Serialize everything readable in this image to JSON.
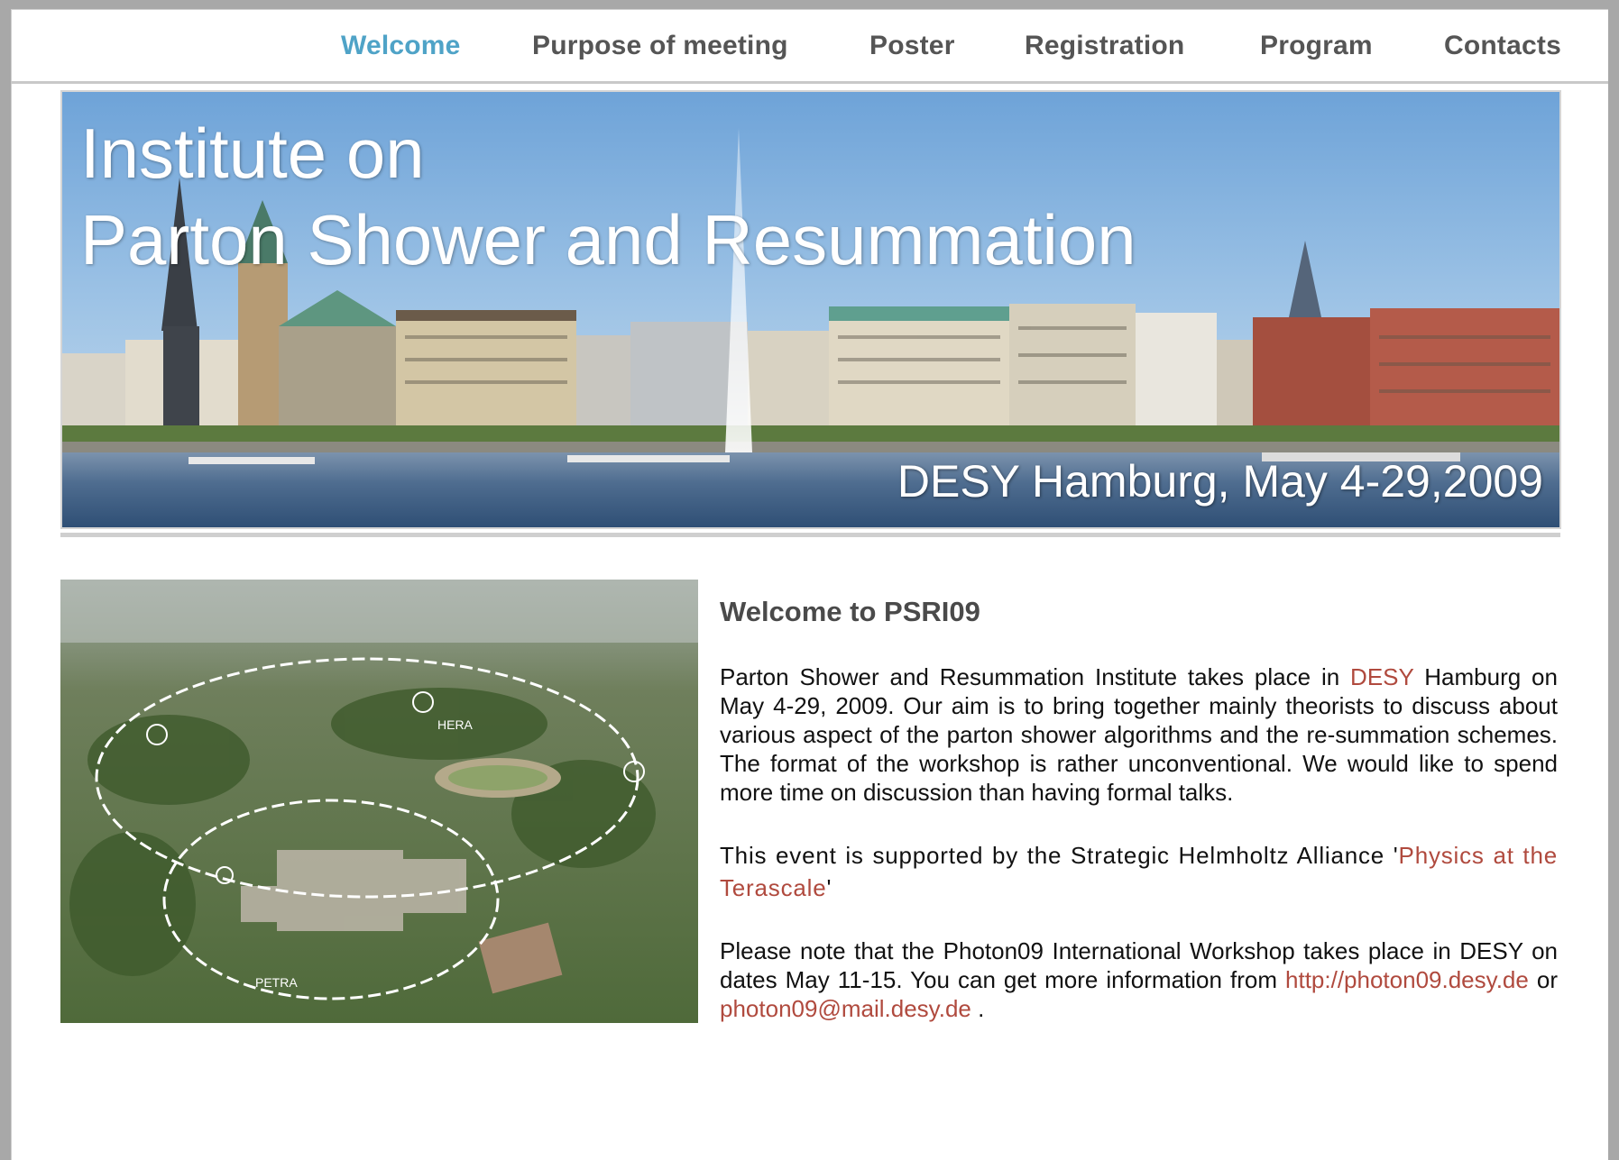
{
  "nav": {
    "items": [
      {
        "label": "Welcome",
        "active": true
      },
      {
        "label": "Purpose of meeting"
      },
      {
        "label": "Poster"
      },
      {
        "label": "Registration"
      },
      {
        "label": "Program"
      },
      {
        "label": "Contacts"
      }
    ]
  },
  "banner": {
    "title_line1": "Institute on",
    "title_line2": "Parton Shower and Resummation",
    "subtitle": "DESY Hamburg, May 4-29,2009"
  },
  "aerial": {
    "label_hera": "HERA",
    "label_petra": "PETRA"
  },
  "content": {
    "heading": "Welcome to PSRI09",
    "p1_text_a": "Parton Shower and Resummation Institute  takes place in ",
    "p1_link": "DESY",
    "p1_text_b": " Hamburg on May 4-29, 2009. Our aim is to bring together mainly theorists to discuss about various aspect of the parton shower algorithms  and the re-summation schemes. The format of the workshop is rather unconventional. We would like to spend more time on discussion than having formal talks.",
    "p2_text_a": "This event is supported by the Strategic Helmholtz Alliance '",
    "p2_link": "Physics at the Terascale",
    "p2_text_b": "'",
    "p3_text_a": "Please note that the Photon09 International Workshop takes place in DESY on dates May 11-15. You can get more information from ",
    "p3_link1": "http://photon09.desy.de",
    "p3_text_b": " or ",
    "p3_link2": "photon09@mail.desy.de",
    "p3_text_c": " ."
  },
  "colors": {
    "nav_active": "#4fa3c7",
    "nav_text": "#555555",
    "link": "#b04a3e"
  }
}
